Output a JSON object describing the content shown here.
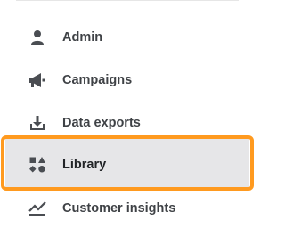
{
  "nav": {
    "items": [
      {
        "label": "Admin",
        "icon": "user-icon"
      },
      {
        "label": "Campaigns",
        "icon": "megaphone-icon"
      },
      {
        "label": "Data exports",
        "icon": "download-tray-icon"
      },
      {
        "label": "Library",
        "icon": "shapes-icon",
        "active": true
      },
      {
        "label": "Customer insights",
        "icon": "trend-line-icon"
      }
    ]
  },
  "colors": {
    "icon": "#4a4d52",
    "active_bg": "#e6e6e8",
    "highlight": "#ff9a1f"
  }
}
